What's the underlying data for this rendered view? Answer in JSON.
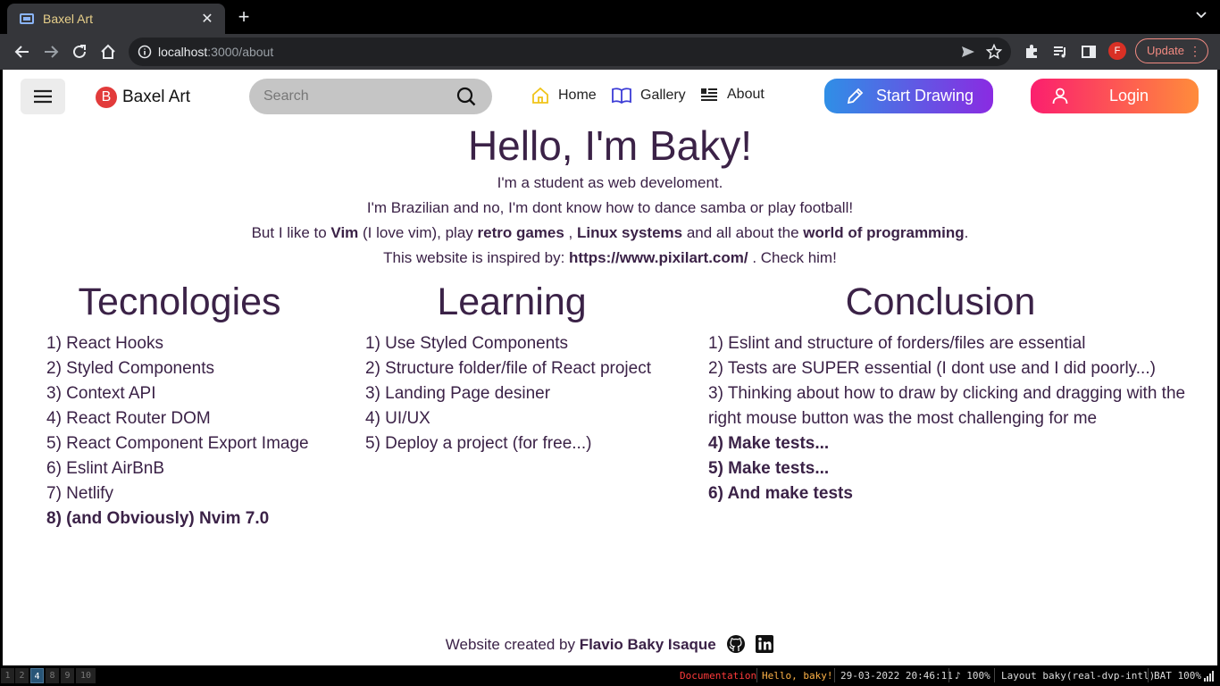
{
  "browser": {
    "tab_title": "Baxel Art",
    "tab_close": "✕",
    "new_tab": "+",
    "url_host": "localhost",
    "url_path": ":3000/about",
    "update_label": "Update",
    "profile_initial": "F"
  },
  "nav": {
    "brand_logo": "B",
    "brand_name": "Baxel Art",
    "search_placeholder": "Search",
    "links": [
      {
        "label": "Home",
        "icon": "home-icon"
      },
      {
        "label": "Gallery",
        "icon": "book-icon"
      },
      {
        "label": "About",
        "icon": "list-icon"
      }
    ],
    "start_drawing": "Start Drawing",
    "login": "Login"
  },
  "hero": {
    "title": "Hello, I'm Baky!",
    "line1": "I'm a student as web develoment.",
    "line2": "I'm Brazilian and no, I'm dont know how to dance samba or play football!",
    "line3": {
      "p1": "But I like to ",
      "b1": "Vim",
      "p2": " (I love vim), play ",
      "b2": "retro games",
      "p3": " , ",
      "b3": "Linux systems",
      "p4": " and all about the ",
      "b4": "world of programming",
      "p5": "."
    },
    "line4": {
      "p1": "This website is inspired by: ",
      "b1": "https://www.pixilart.com/",
      "p2": " . Check him!"
    }
  },
  "columns": {
    "technologies": {
      "title": "Tecnologies",
      "items": [
        "1) React Hooks",
        "2) Styled Components",
        "3) Context API",
        "4) React Router DOM",
        "5) React Component Export Image",
        "6) Eslint AirBnB",
        "7) Netlify",
        "8) (and Obviously) Nvim 7.0"
      ]
    },
    "learning": {
      "title": "Learning",
      "items": [
        "1) Use Styled Components",
        "2) Structure folder/file of React project",
        "3) Landing Page desiner",
        "4) UI/UX",
        "5) Deploy a project (for free...)"
      ]
    },
    "conclusion": {
      "title": "Conclusion",
      "items": [
        "1) Eslint and structure of forders/files are essential",
        "2) Tests are SUPER essential (I dont use and I did poorly...)",
        "3) Thinking about how to draw by clicking and dragging with the right mouse button was the most challenging for me",
        "4) Make tests...",
        "5) Make tests...",
        "6) And make tests"
      ]
    }
  },
  "footer": {
    "prefix": "Website created by ",
    "author": "Flavio Baky Isaque"
  },
  "statusbar": {
    "workspaces": [
      "1",
      "2",
      "4",
      "8",
      "9",
      "10"
    ],
    "active_workspace": "4",
    "documentation": "Documentation",
    "greeting": "Hello, baky!",
    "datetime": "29-03-2022 20:46:11",
    "volume": "♪ 100%",
    "layout": "Layout baky(real-dvp-intl)",
    "battery": "BAT 100%"
  },
  "colors": {
    "text": "#3b2247",
    "draw_gradient": [
      "#2f8fe6",
      "#8a2be2"
    ],
    "login_gradient": [
      "#fb1f6e",
      "#ff8c3b"
    ]
  }
}
